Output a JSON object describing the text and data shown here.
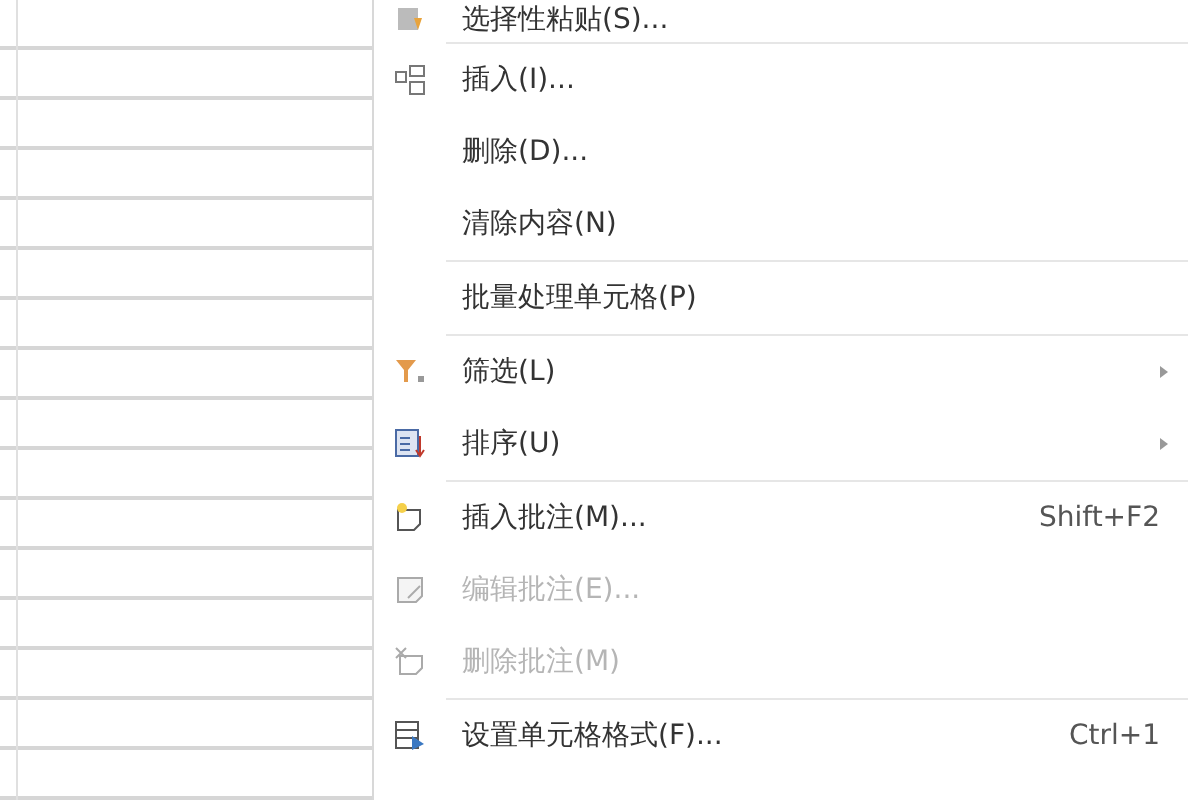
{
  "context_menu": {
    "items": [
      {
        "label": "选择性粘贴(S)...",
        "disabled": false,
        "separator_after": true
      },
      {
        "label": "插入(I)...",
        "disabled": false
      },
      {
        "label": "删除(D)...",
        "disabled": false
      },
      {
        "label": "清除内容(N)",
        "disabled": false,
        "separator_after": true
      },
      {
        "label": "批量处理单元格(P)",
        "disabled": false,
        "separator_after": true
      },
      {
        "label": "筛选(L)",
        "disabled": false,
        "submenu": true
      },
      {
        "label": "排序(U)",
        "disabled": false,
        "submenu": true,
        "separator_after": true
      },
      {
        "label": "插入批注(M)...",
        "disabled": false,
        "shortcut": "Shift+F2"
      },
      {
        "label": "编辑批注(E)...",
        "disabled": true
      },
      {
        "label": "删除批注(M)",
        "disabled": true,
        "separator_after": true
      },
      {
        "label": "设置单元格格式(F)...",
        "disabled": false,
        "shortcut": "Ctrl+1"
      }
    ]
  }
}
